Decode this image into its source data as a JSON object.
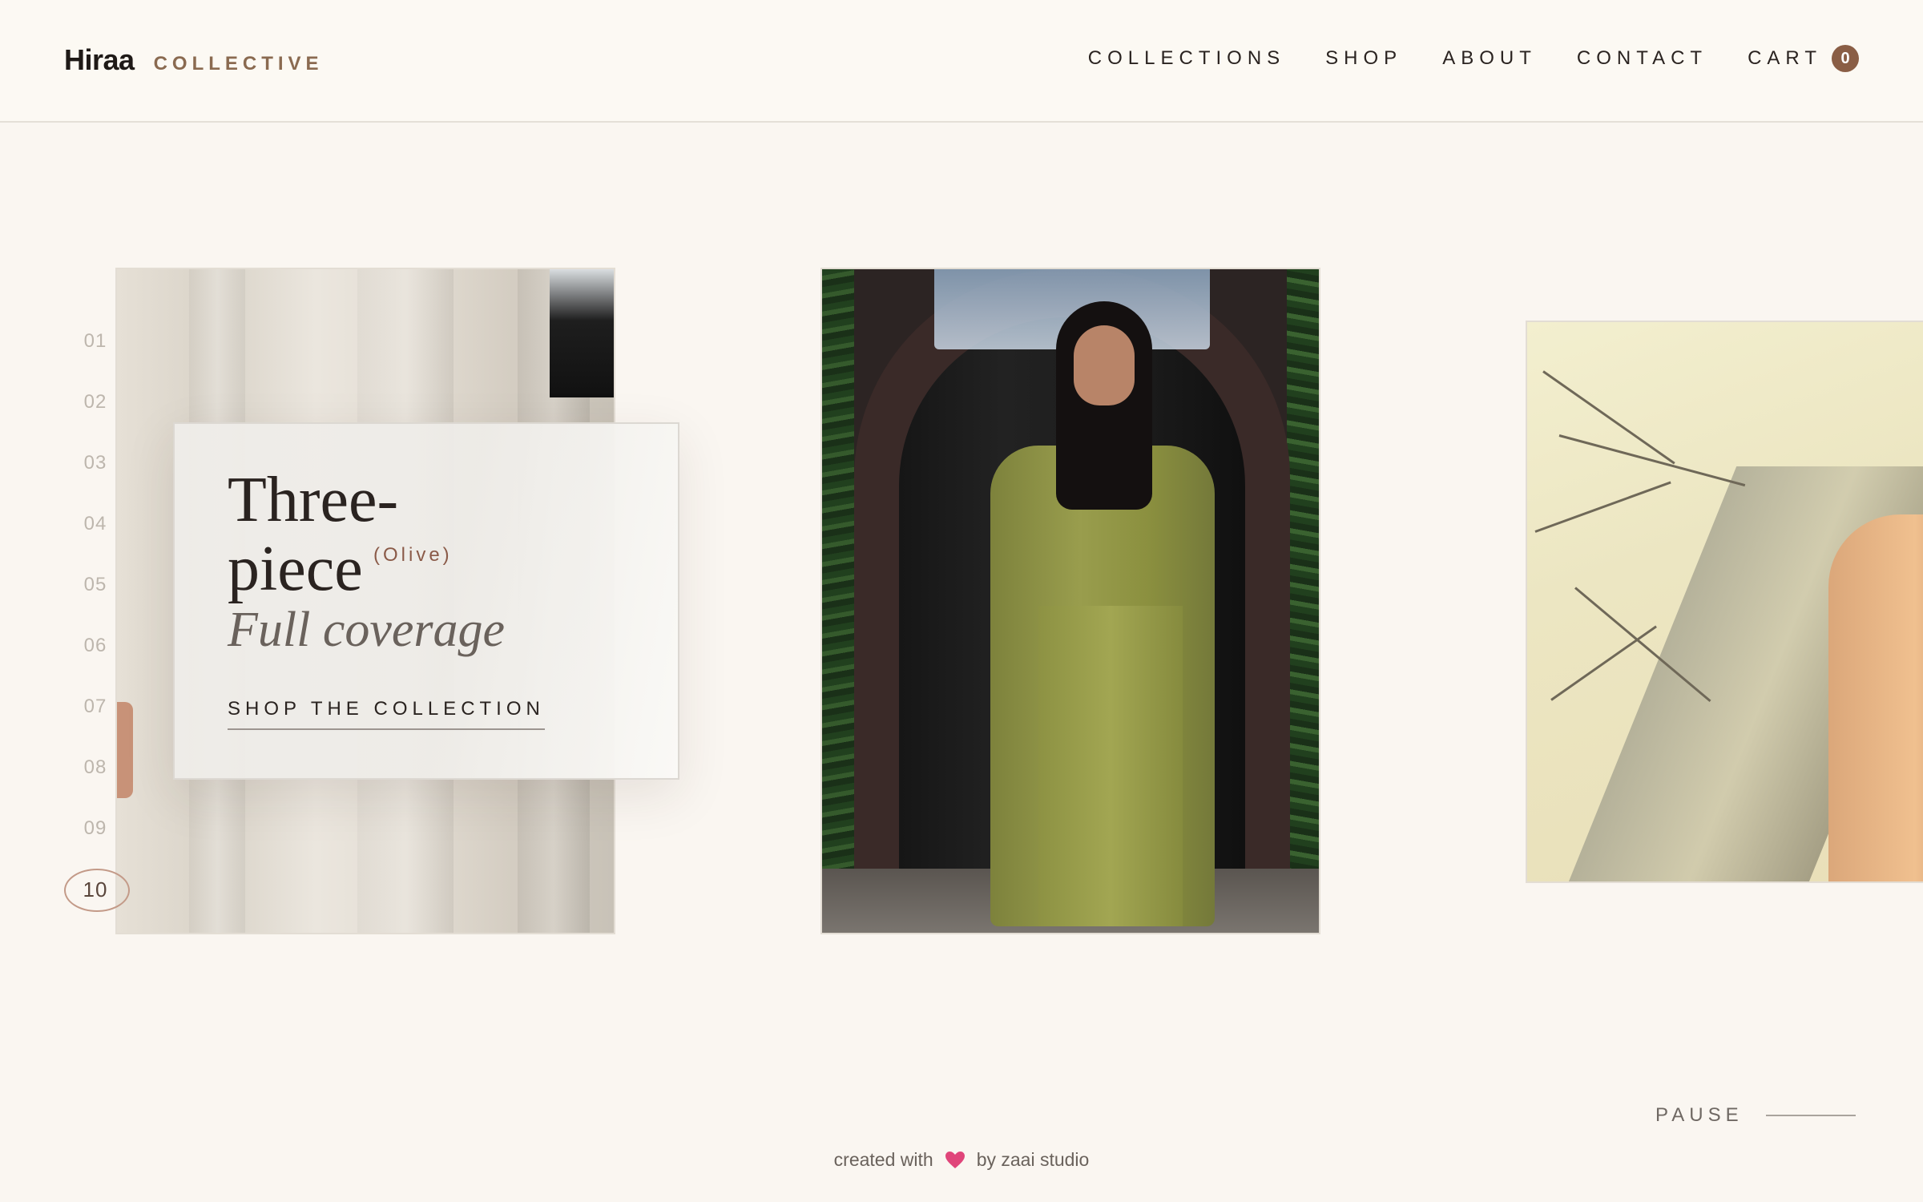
{
  "header": {
    "brand_name": "Hiraa",
    "brand_sub": "COLLECTIVE",
    "nav": [
      "COLLECTIONS",
      "SHOP",
      "ABOUT",
      "CONTACT"
    ],
    "cart_label": "CART",
    "cart_count": "0"
  },
  "slider": {
    "indices": [
      "01",
      "02",
      "03",
      "04",
      "05",
      "06",
      "07",
      "08",
      "09",
      "10"
    ],
    "active_index": "10",
    "pause_label": "PAUSE"
  },
  "card": {
    "title_line1": "Three-",
    "title_line2": "piece",
    "tag": "(Olive)",
    "subtitle": "Full coverage",
    "cta": "SHOP THE COLLECTION"
  },
  "footer": {
    "before": "created with",
    "after": "by zaai studio"
  },
  "colors": {
    "accent": "#8a5e45",
    "background": "#faf6f1",
    "heart": "#e0457a"
  }
}
